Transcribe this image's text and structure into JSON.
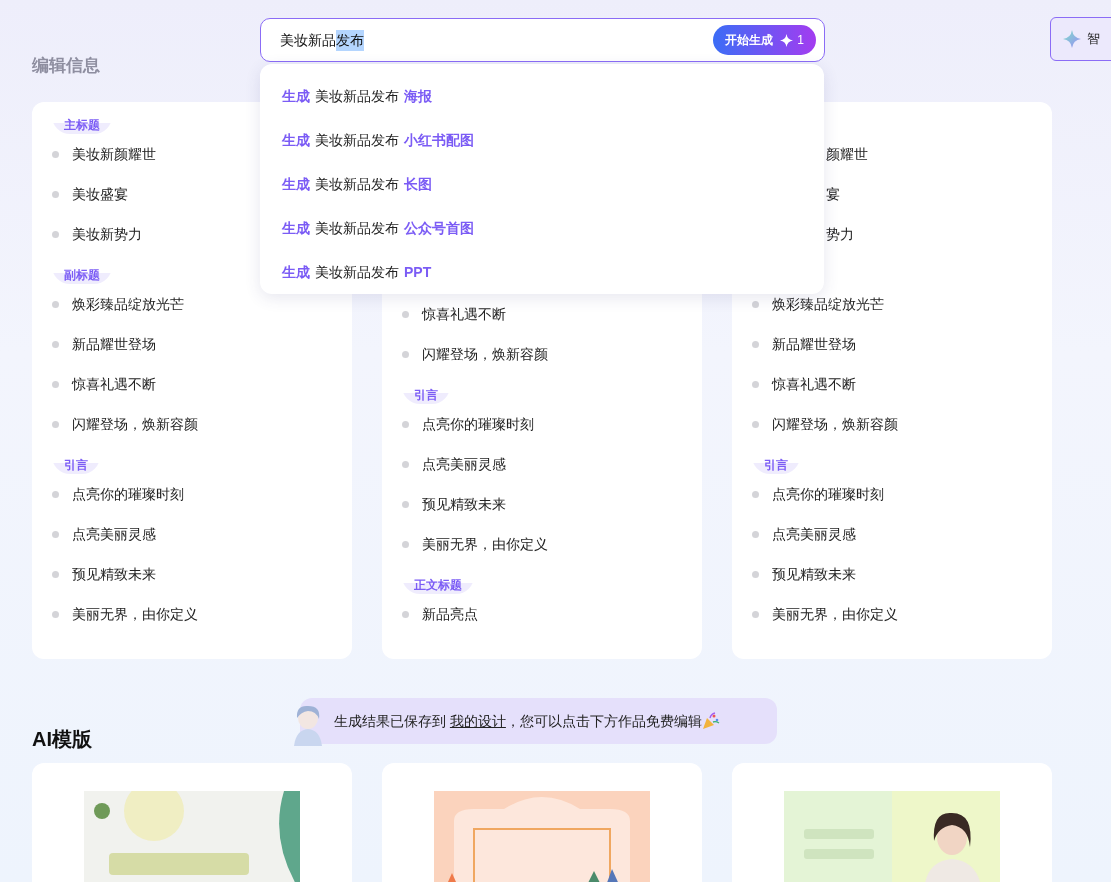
{
  "search": {
    "value_parts": [
      {
        "text": "美妆新品",
        "selected": false
      },
      {
        "text": "发布",
        "selected": true
      }
    ],
    "button": {
      "label": "开始生成",
      "count": "1"
    }
  },
  "side_button": {
    "label": "智"
  },
  "suggestions": [
    {
      "prefix": "生成",
      "query": "美妆新品发布",
      "type": "海报"
    },
    {
      "prefix": "生成",
      "query": "美妆新品发布",
      "type": "小红书配图"
    },
    {
      "prefix": "生成",
      "query": "美妆新品发布",
      "type": "长图"
    },
    {
      "prefix": "生成",
      "query": "美妆新品发布",
      "type": "公众号首图"
    },
    {
      "prefix": "生成",
      "query": "美妆新品发布",
      "type": "PPT"
    }
  ],
  "edit_section": {
    "title": "编辑信息",
    "columns": [
      {
        "sections": [
          {
            "label": "主标题",
            "items": [
              {
                "kind": "item",
                "text": "美妆新颜耀世"
              },
              {
                "kind": "item",
                "text": "美妆盛宴"
              },
              {
                "kind": "item",
                "text": "美妆新势力"
              }
            ]
          },
          {
            "label": "副标题",
            "items": [
              {
                "kind": "item",
                "text": "焕彩臻品绽放光芒"
              },
              {
                "kind": "item",
                "text": "新品耀世登场"
              },
              {
                "kind": "item",
                "text": "惊喜礼遇不断"
              },
              {
                "kind": "item",
                "text": "闪耀登场，焕新容颜"
              }
            ]
          },
          {
            "label": "引言",
            "items": [
              {
                "kind": "item",
                "text": "点亮你的璀璨时刻"
              },
              {
                "kind": "item",
                "text": "点亮美丽灵感"
              },
              {
                "kind": "item",
                "text": "预见精致未来"
              },
              {
                "kind": "item",
                "text": "美丽无界，由你定义"
              }
            ]
          }
        ]
      },
      {
        "sections": [
          {
            "items": [
              {
                "kind": "item",
                "text": "惊喜礼遇不断"
              },
              {
                "kind": "item",
                "text": "闪耀登场，焕新容颜"
              }
            ]
          },
          {
            "label": "引言",
            "items": [
              {
                "kind": "item",
                "text": "点亮你的璀璨时刻"
              },
              {
                "kind": "item",
                "text": "点亮美丽灵感"
              },
              {
                "kind": "item",
                "text": "预见精致未来"
              },
              {
                "kind": "item",
                "text": "美丽无界，由你定义"
              }
            ]
          },
          {
            "label": "正文标题",
            "items": [
              {
                "kind": "item",
                "text": "新品亮点"
              }
            ]
          }
        ]
      },
      {
        "sections": [
          {
            "items": [
              {
                "kind": "clipped",
                "text": "颜耀世"
              },
              {
                "kind": "clipped",
                "text": "宴"
              },
              {
                "kind": "clipped",
                "text": "势力"
              }
            ]
          },
          {
            "items": [
              {
                "kind": "item",
                "text": "焕彩臻品绽放光芒"
              },
              {
                "kind": "item",
                "text": "新品耀世登场"
              },
              {
                "kind": "item",
                "text": "惊喜礼遇不断"
              },
              {
                "kind": "item",
                "text": "闪耀登场，焕新容颜"
              }
            ]
          },
          {
            "label": "引言",
            "items": [
              {
                "kind": "item",
                "text": "点亮你的璀璨时刻"
              },
              {
                "kind": "item",
                "text": "点亮美丽灵感"
              },
              {
                "kind": "item",
                "text": "预见精致未来"
              },
              {
                "kind": "item",
                "text": "美丽无界，由你定义"
              }
            ]
          }
        ]
      }
    ]
  },
  "toast": {
    "before": "生成结果已保存到",
    "link": "我的设计",
    "after": "，您可以点击下方作品免费编辑"
  },
  "templates": {
    "title": "AI模版"
  }
}
